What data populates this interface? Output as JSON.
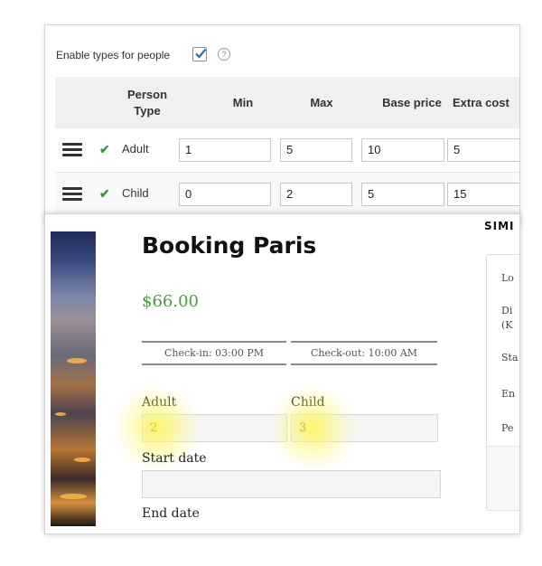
{
  "admin": {
    "enable_label": "Enable types for people",
    "enabled": true,
    "help_glyph": "?",
    "columns": [
      "Person Type",
      "Min",
      "Max",
      "Base price",
      "Extra cost"
    ],
    "rows": [
      {
        "type": "Adult",
        "min": "1",
        "max": "5",
        "base_price": "10",
        "extra_cost": "5"
      },
      {
        "type": "Child",
        "min": "0",
        "max": "2",
        "base_price": "5",
        "extra_cost": "15"
      }
    ],
    "check_color": "#3c9a3c"
  },
  "booking": {
    "title": "Booking Paris",
    "price": "$66.00",
    "price_color": "#4e9a3e",
    "checkin": "Check-in: 03:00 PM",
    "checkout": "Check-out: 10:00 AM",
    "adult_label": "Adult",
    "adult_value": "2",
    "child_label": "Child",
    "child_value": "3",
    "start_date_label": "Start date",
    "end_date_label": "End date",
    "highlight_color": "#fff550"
  },
  "sidebar": {
    "title": "SIMI",
    "items": [
      "Lo",
      "Di",
      "(K",
      "Sta",
      "En",
      "Pe"
    ]
  }
}
